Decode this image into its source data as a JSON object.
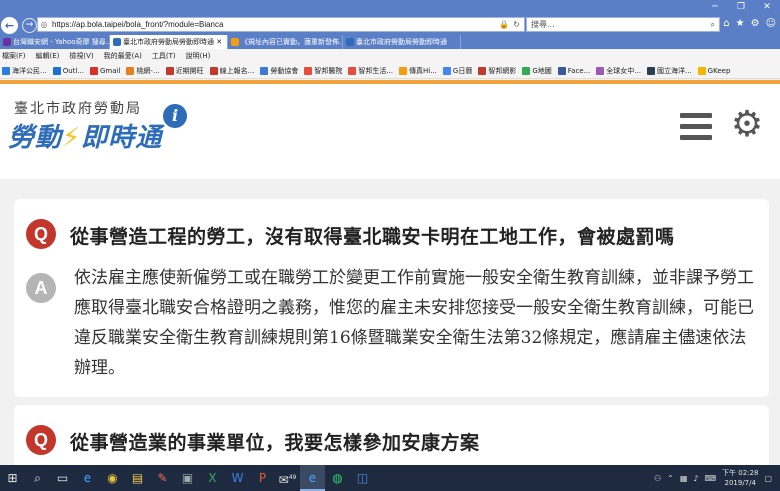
{
  "browser": {
    "address": "https://ap.bola.taipei/bola_front/?module=Bianca",
    "search_placeholder": "搜尋...",
    "tabs": [
      "台灣職安網 - Yahoo奇摩 搜尋...",
      "臺北市政府勞動局勞動即時通",
      "《規址內容已實動，蓮重新發佈...",
      "臺北市政府勞動局勞動即時通"
    ],
    "menu": [
      "檔案(F)",
      "編輯(E)",
      "檢視(V)",
      "我的最愛(A)",
      "工具(T)",
      "說明(H)"
    ],
    "favorites": [
      "海洋公民...",
      "Outl...",
      "Gmail",
      "桃網-...",
      "近期開旺",
      "線上報名...",
      "勞動協會",
      "智邦醫院",
      "智邦生活...",
      "傳真Hi...",
      "G日曆",
      "智邦網影",
      "G地圖",
      "Face...",
      "全球女中...",
      "國立海洋...",
      "GKeep"
    ],
    "fav_colors": [
      "#2a7de1",
      "#1f6fd6",
      "#d93025",
      "#e67e22",
      "#c0392b",
      "#c0392b",
      "#3a7bd5",
      "#e74c3c",
      "#e74c3c",
      "#f39c12",
      "#4285f4",
      "#c0392b",
      "#34a853",
      "#3b5998",
      "#9b59b6",
      "#2c3e50",
      "#f4b400"
    ]
  },
  "site": {
    "org_name": "臺北市政府勞動局",
    "logo_part1": "勞動",
    "logo_part2": "即時通",
    "info_letter": "i"
  },
  "faq": [
    {
      "q_badge": "Q",
      "question": "從事營造工程的勞工，沒有取得臺北職安卡明在工地工作，會被處罰嗎",
      "a_badge": "A",
      "answer": "依法雇主應使新僱勞工或在職勞工於變更工作前實施一般安全衛生教育訓練，並非課予勞工應取得臺北職安合格證明之義務，惟您的雇主未安排您接受一般安全衛生教育訓練，可能已違反職業安全衛生教育訓練規則第16條暨職業安全衛生法第32條規定，應請雇主儘速依法辦理。"
    },
    {
      "q_badge": "Q",
      "question": "從事營造業的事業單位，我要怎樣參加安康方案"
    }
  ],
  "taskbar": {
    "mail_badge": "49",
    "time": "下午 02:28",
    "date": "2019/7/4"
  },
  "colors": {
    "brand_blue": "#2d6cb8",
    "question_red": "#c3362b",
    "accent_orange": "#f0a23a"
  }
}
